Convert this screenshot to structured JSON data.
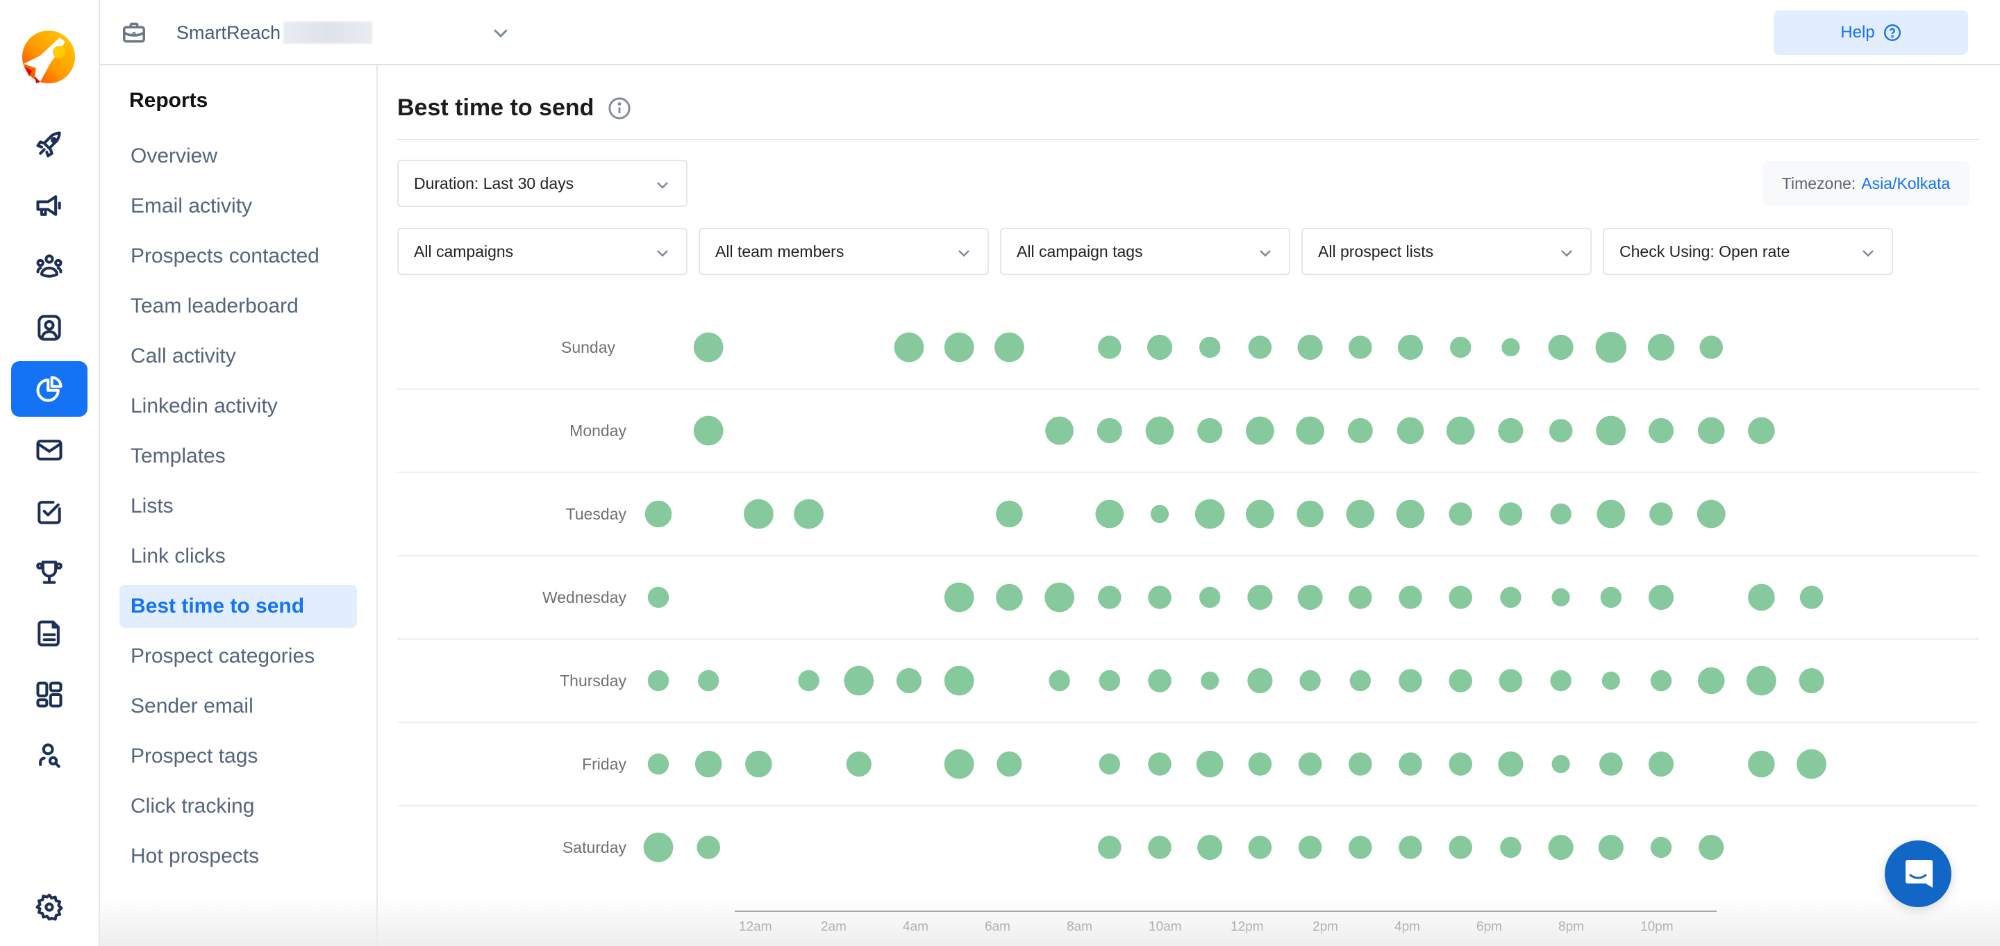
{
  "app": {
    "workspace_name": "SmartReach",
    "help_label": "Help"
  },
  "rail": {
    "items": [
      {
        "icon": "rocket-icon"
      },
      {
        "icon": "megaphone-icon"
      },
      {
        "icon": "team-icon"
      },
      {
        "icon": "contact-icon"
      },
      {
        "icon": "reports-pie-icon",
        "active": true
      },
      {
        "icon": "mail-icon"
      },
      {
        "icon": "task-check-icon"
      },
      {
        "icon": "trophy-icon"
      },
      {
        "icon": "document-icon"
      },
      {
        "icon": "dashboard-grid-icon"
      },
      {
        "icon": "prospect-search-icon"
      },
      {
        "icon": "settings-gear-icon"
      }
    ]
  },
  "reports_nav": {
    "title": "Reports",
    "items": [
      "Overview",
      "Email activity",
      "Prospects contacted",
      "Team leaderboard",
      "Call activity",
      "Linkedin activity",
      "Templates",
      "Lists",
      "Link clicks",
      "Best time to send",
      "Prospect categories",
      "Sender email",
      "Prospect tags",
      "Click tracking",
      "Hot prospects"
    ],
    "active_index": 9
  },
  "page": {
    "title": "Best time to send",
    "duration": "Duration:  Last 30 days",
    "timezone_label": "Timezone:",
    "timezone_value": "Asia/Kolkata",
    "filters": [
      "All campaigns",
      "All team members",
      "All campaign tags",
      "All prospect lists",
      "Check Using:  Open rate"
    ]
  },
  "colors": {
    "accent": "#1473f5",
    "bubble": "#86c99c",
    "chat": "#1266c6"
  },
  "chart_data": {
    "type": "scatter",
    "title": "Best time to send",
    "metric": "Open rate (relative bubble size, 1-10)",
    "xlabel": "",
    "ylabel": "",
    "x_tick_labels": [
      "12am",
      "2am",
      "4am",
      "6am",
      "8am",
      "10am",
      "12pm",
      "2pm",
      "4pm",
      "6pm",
      "8pm",
      "10pm"
    ],
    "categories": [
      "Sunday",
      "Monday",
      "Tuesday",
      "Wednesday",
      "Thursday",
      "Friday",
      "Saturday"
    ],
    "x_range_hours": [
      0,
      23
    ],
    "grid": "horizontal row dividers",
    "series": [
      {
        "name": "Sunday",
        "points": [
          [
            1,
            7
          ],
          [
            5,
            7
          ],
          [
            6,
            7
          ],
          [
            7,
            7
          ],
          [
            9,
            3
          ],
          [
            10,
            4
          ],
          [
            11,
            2
          ],
          [
            12,
            3
          ],
          [
            13,
            4
          ],
          [
            14,
            3
          ],
          [
            15,
            4
          ],
          [
            16,
            2
          ],
          [
            17,
            1
          ],
          [
            18,
            4
          ],
          [
            19,
            8
          ],
          [
            20,
            5
          ],
          [
            21,
            3
          ]
        ]
      },
      {
        "name": "Monday",
        "points": [
          [
            1,
            7
          ],
          [
            8,
            6
          ],
          [
            9,
            4
          ],
          [
            10,
            6
          ],
          [
            11,
            4
          ],
          [
            12,
            6
          ],
          [
            13,
            6
          ],
          [
            14,
            4
          ],
          [
            15,
            5
          ],
          [
            16,
            6
          ],
          [
            17,
            4
          ],
          [
            18,
            3
          ],
          [
            19,
            7
          ],
          [
            20,
            4
          ],
          [
            21,
            5
          ],
          [
            22,
            5
          ]
        ]
      },
      {
        "name": "Tuesday",
        "points": [
          [
            0,
            5
          ],
          [
            2,
            7
          ],
          [
            3,
            7
          ],
          [
            7,
            5
          ],
          [
            9,
            6
          ],
          [
            10,
            1
          ],
          [
            11,
            7
          ],
          [
            12,
            6
          ],
          [
            13,
            5
          ],
          [
            14,
            6
          ],
          [
            15,
            6
          ],
          [
            16,
            3
          ],
          [
            17,
            3
          ],
          [
            18,
            2
          ],
          [
            19,
            6
          ],
          [
            20,
            3
          ],
          [
            21,
            6
          ]
        ]
      },
      {
        "name": "Wednesday",
        "points": [
          [
            0,
            2
          ],
          [
            6,
            7
          ],
          [
            7,
            5
          ],
          [
            8,
            7
          ],
          [
            9,
            3
          ],
          [
            10,
            3
          ],
          [
            11,
            2
          ],
          [
            12,
            4
          ],
          [
            13,
            4
          ],
          [
            14,
            3
          ],
          [
            15,
            3
          ],
          [
            16,
            3
          ],
          [
            17,
            2
          ],
          [
            18,
            1
          ],
          [
            19,
            2
          ],
          [
            20,
            4
          ],
          [
            22,
            5
          ],
          [
            23,
            3
          ]
        ]
      },
      {
        "name": "Thursday",
        "points": [
          [
            0,
            2
          ],
          [
            1,
            2
          ],
          [
            3,
            2
          ],
          [
            4,
            7
          ],
          [
            5,
            4
          ],
          [
            6,
            7
          ],
          [
            8,
            2
          ],
          [
            9,
            2
          ],
          [
            10,
            3
          ],
          [
            11,
            1
          ],
          [
            12,
            4
          ],
          [
            13,
            2
          ],
          [
            14,
            2
          ],
          [
            15,
            3
          ],
          [
            16,
            3
          ],
          [
            17,
            3
          ],
          [
            18,
            2
          ],
          [
            19,
            1
          ],
          [
            20,
            2
          ],
          [
            21,
            5
          ],
          [
            22,
            7
          ],
          [
            23,
            4
          ]
        ]
      },
      {
        "name": "Friday",
        "points": [
          [
            0,
            2
          ],
          [
            1,
            5
          ],
          [
            2,
            5
          ],
          [
            4,
            4
          ],
          [
            6,
            7
          ],
          [
            7,
            4
          ],
          [
            9,
            2
          ],
          [
            10,
            3
          ],
          [
            11,
            5
          ],
          [
            12,
            3
          ],
          [
            13,
            3
          ],
          [
            14,
            3
          ],
          [
            15,
            3
          ],
          [
            16,
            3
          ],
          [
            17,
            4
          ],
          [
            18,
            1
          ],
          [
            19,
            3
          ],
          [
            20,
            4
          ],
          [
            22,
            5
          ],
          [
            23,
            7
          ]
        ]
      },
      {
        "name": "Saturday",
        "points": [
          [
            0,
            7
          ],
          [
            1,
            3
          ],
          [
            9,
            3
          ],
          [
            10,
            3
          ],
          [
            11,
            4
          ],
          [
            12,
            3
          ],
          [
            13,
            3
          ],
          [
            14,
            3
          ],
          [
            15,
            3
          ],
          [
            16,
            3
          ],
          [
            17,
            2
          ],
          [
            18,
            4
          ],
          [
            19,
            4
          ],
          [
            20,
            2
          ],
          [
            21,
            4
          ]
        ]
      }
    ]
  }
}
